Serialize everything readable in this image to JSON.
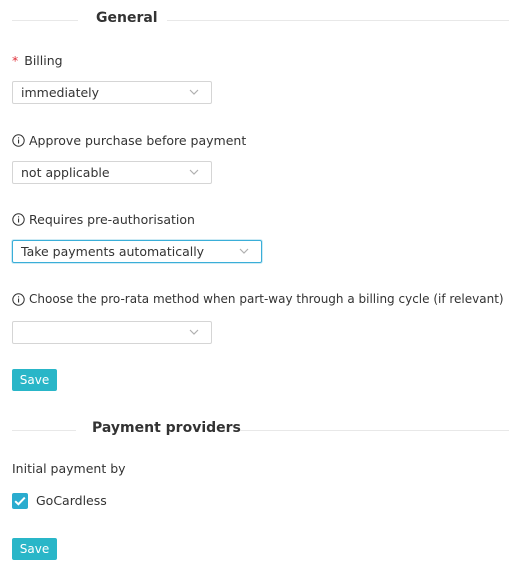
{
  "general": {
    "title": "General",
    "billing": {
      "required_mark": "*",
      "label": "Billing",
      "value": "immediately"
    },
    "approve_purchase": {
      "label": "Approve purchase before payment",
      "value": "not applicable"
    },
    "pre_authorisation": {
      "label": "Requires pre-authorisation",
      "value": "Take payments automatically"
    },
    "pro_rata": {
      "label": "Choose the pro-rata method when part-way through a billing cycle (if relevant)",
      "value": ""
    },
    "save_label": "Save"
  },
  "payment_providers": {
    "title": "Payment providers",
    "initial_payment_label": "Initial payment by",
    "gocardless": {
      "label": "GoCardless",
      "checked": true
    },
    "save_label": "Save"
  },
  "colors": {
    "accent": "#29b6c8",
    "required": "#e0303a",
    "focus_border": "#3aaed8"
  },
  "icons": [
    "info-icon",
    "chevron-down-icon",
    "checkmark-icon"
  ]
}
